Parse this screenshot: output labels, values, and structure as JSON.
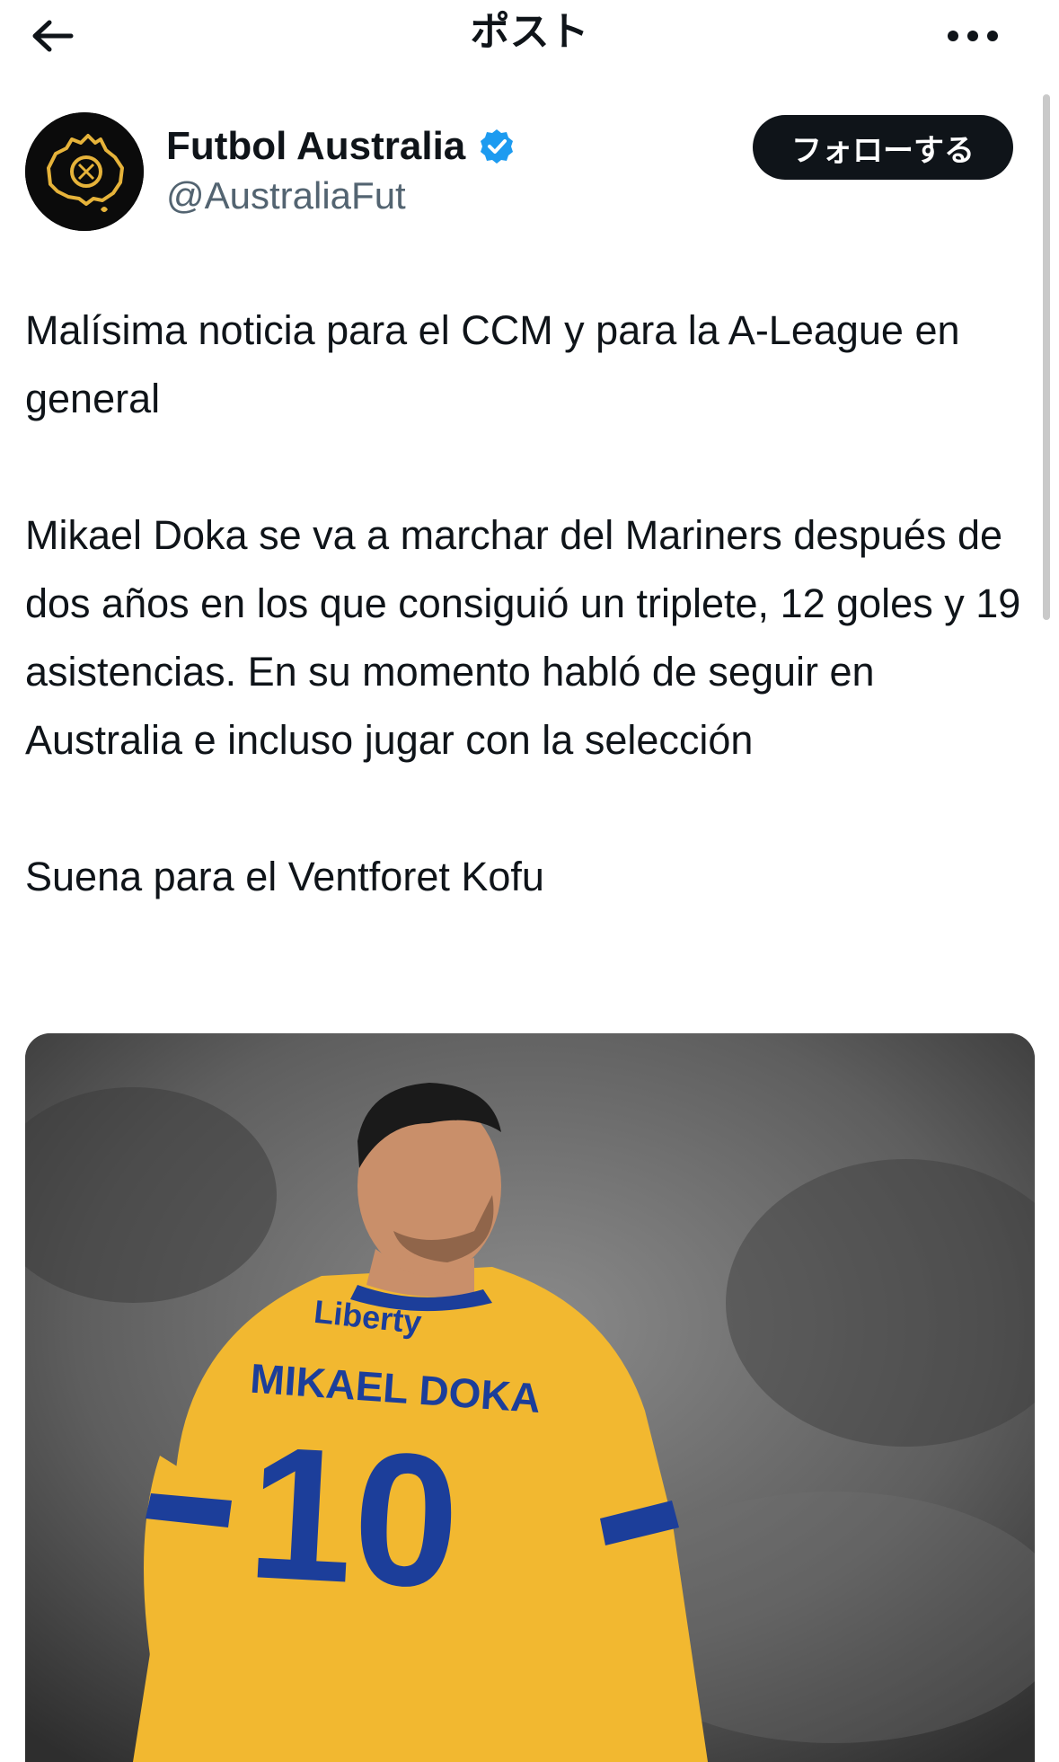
{
  "header": {
    "title": "ポスト"
  },
  "account": {
    "display_name": "Futbol Australia",
    "handle": "@AustraliaFut",
    "follow_label": "フォローする"
  },
  "post": {
    "paragraphs": [
      "Malísima noticia para el CCM y para la A-League en general",
      "Mikael Doka se va a marchar del Mariners después de dos años en los que consiguió un triplete, 12 goles y 19 asistencias. En su momento habló de seguir en Australia e incluso jugar con la selección",
      "Suena para el Ventforet Kofu"
    ]
  },
  "media": {
    "jersey_sponsor": "Liberty",
    "jersey_name": "MIKAEL DOKA",
    "jersey_number": "10"
  },
  "colors": {
    "verified": "#1d9bf0",
    "jersey_yellow": "#f2b830",
    "jersey_blue": "#1c3e9a",
    "gold_logo": "#e6b33a"
  },
  "icons": [
    "back-arrow-icon",
    "more-icon",
    "verified-badge-icon"
  ]
}
